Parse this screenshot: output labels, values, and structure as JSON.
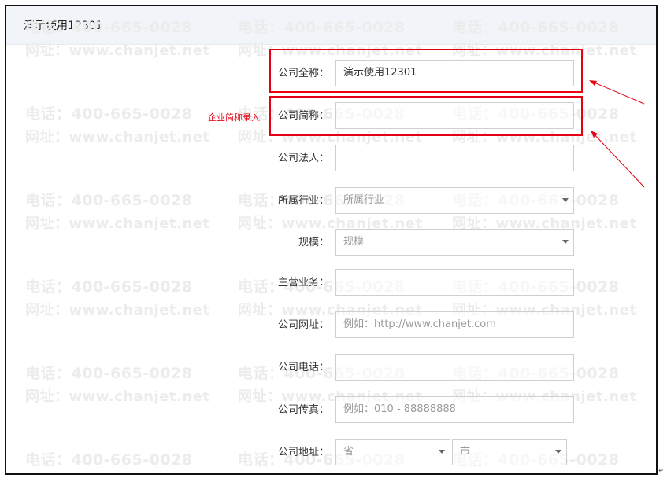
{
  "header": {
    "company_name": "演示使用12301"
  },
  "watermark": {
    "phone": "电话：400-665-0028",
    "url": "网址：www.chanjet.net"
  },
  "annotation": {
    "text": "企业简称录入"
  },
  "form": {
    "full_name": {
      "label": "公司全称：",
      "value": "演示使用12301"
    },
    "short_name": {
      "label": "公司简称：",
      "value": ""
    },
    "legal_person": {
      "label": "公司法人：",
      "value": ""
    },
    "industry": {
      "label": "所属行业：",
      "selected": "所属行业"
    },
    "scale": {
      "label": "规模：",
      "selected": "规模"
    },
    "main_business": {
      "label": "主营业务：",
      "value": ""
    },
    "website": {
      "label": "公司网址：",
      "placeholder": "例如：http://www.chanjet.com"
    },
    "phone": {
      "label": "公司电话：",
      "value": ""
    },
    "fax": {
      "label": "公司传真：",
      "placeholder": "例如：010 - 88888888"
    },
    "address": {
      "label": "公司地址：",
      "province": "省",
      "city": "市"
    }
  },
  "colors": {
    "highlight": "#e60012",
    "topbar": "#f1f5fa"
  }
}
